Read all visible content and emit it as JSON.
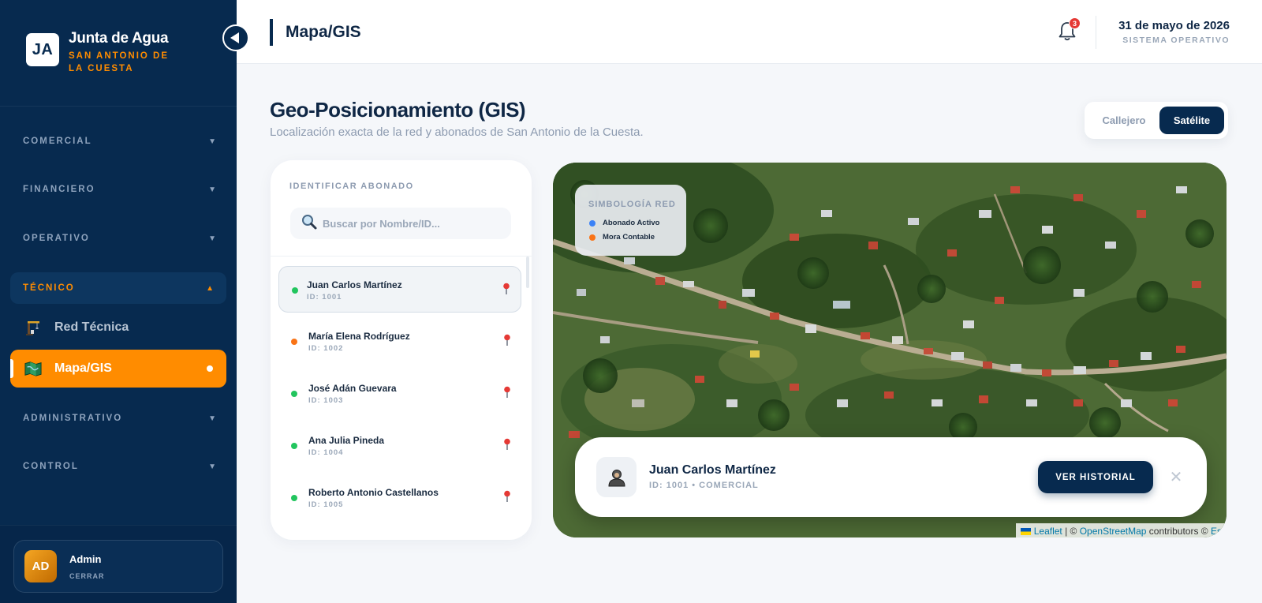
{
  "brand": {
    "logo": "JA",
    "name": "Junta de Agua",
    "subtitle": "SAN ANTONIO DE LA CUESTA"
  },
  "sidebar": {
    "sections": [
      {
        "label": "COMERCIAL",
        "state": "collapsed"
      },
      {
        "label": "FINANCIERO",
        "state": "collapsed"
      },
      {
        "label": "OPERATIVO",
        "state": "collapsed"
      },
      {
        "label": "TÉCNICO",
        "state": "expanded"
      },
      {
        "label": "ADMINISTRATIVO",
        "state": "collapsed"
      },
      {
        "label": "CONTROL",
        "state": "collapsed"
      }
    ],
    "tecnico_items": [
      {
        "label": "Red Técnica",
        "icon": "construction-crane-icon"
      },
      {
        "label": "Mapa/GIS",
        "icon": "map-icon",
        "active": true
      }
    ]
  },
  "user": {
    "initials": "AD",
    "name": "Admin",
    "logout": "CERRAR"
  },
  "header": {
    "title": "Mapa/GIS",
    "notifications": "3",
    "date": "31 de mayo de 2026",
    "status": "SISTEMA OPERATIVO"
  },
  "main": {
    "title": "Geo-Posicionamiento (GIS)",
    "subtitle": "Localización exacta de la red y abonados de San Antonio de la Cuesta.",
    "view_toggle": {
      "options": [
        "Callejero",
        "Satélite"
      ],
      "selected": "Satélite"
    }
  },
  "panel": {
    "label": "IDENTIFICAR ABONADO",
    "search_placeholder": "Buscar por Nombre/ID...",
    "subscribers": [
      {
        "name": "Juan Carlos Martínez",
        "id": "ID: 1001",
        "status": "active",
        "selected": true
      },
      {
        "name": "María Elena Rodríguez",
        "id": "ID: 1002",
        "status": "mora"
      },
      {
        "name": "José Adán Guevara",
        "id": "ID: 1003",
        "status": "active"
      },
      {
        "name": "Ana Julia Pineda",
        "id": "ID: 1004",
        "status": "active"
      },
      {
        "name": "Roberto Antonio Castellanos",
        "id": "ID: 1005",
        "status": "active"
      }
    ]
  },
  "map": {
    "legend": {
      "title": "SIMBOLOGÍA RED",
      "items": [
        {
          "label": "Abonado Activo",
          "color": "#3b82f6"
        },
        {
          "label": "Mora Contable",
          "color": "#f97316"
        }
      ]
    },
    "card": {
      "name": "Juan Carlos Martínez",
      "meta": "ID: 1001 • COMERCIAL",
      "button": "VER HISTORIAL",
      "close": "✕"
    },
    "attribution": {
      "leaflet": "Leaflet",
      "sep1": " | © ",
      "osm": "OpenStreetMap",
      "contributors": " contributors © ",
      "esri": "Es"
    }
  },
  "colors": {
    "navy": "#072a4f",
    "accent": "#ff8c00",
    "active_dot": "#22c55e",
    "mora_dot": "#f97316"
  }
}
